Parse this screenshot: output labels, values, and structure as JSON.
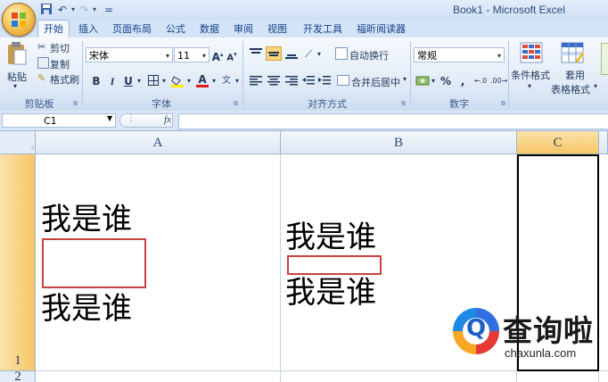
{
  "window": {
    "title": "Book1 - Microsoft Excel"
  },
  "quick_access": {
    "undo_icon": "undo-icon",
    "redo_icon": "redo-icon",
    "save_icon": "save-icon",
    "customize": "="
  },
  "tabs": [
    "开始",
    "插入",
    "页面布局",
    "公式",
    "数据",
    "审阅",
    "视图",
    "开发工具",
    "福昕阅读器"
  ],
  "active_tab": "开始",
  "ribbon": {
    "clipboard": {
      "paste": "粘贴",
      "cut": "剪切",
      "copy": "复制",
      "format_painter": "格式刷",
      "label": "剪贴板"
    },
    "font": {
      "family": "宋体",
      "size": "11",
      "grow": "A",
      "shrink": "A",
      "bold": "B",
      "italic": "I",
      "underline": "U",
      "label": "字体"
    },
    "alignment": {
      "wrap": "自动换行",
      "merge": "合并后居中",
      "label": "对齐方式"
    },
    "number": {
      "format": "常规",
      "currency": "%",
      "comma": ",",
      "label": "数字"
    },
    "styles": {
      "conditional": "条件格式",
      "table_line1": "套用",
      "table_line2": "表格格式"
    }
  },
  "formula_bar": {
    "name_box": "C1",
    "fx": "fx",
    "value": ""
  },
  "columns": [
    "A",
    "B",
    "C"
  ],
  "selected_column": "C",
  "rows": [
    "1",
    "2"
  ],
  "cells": {
    "A1": {
      "line1": "我是谁",
      "line2": "我是谁"
    },
    "B1": {
      "line1": "我是谁",
      "line2": "我是谁"
    }
  },
  "colors": {
    "selection": "#000000",
    "header_highlight": "#f7c667",
    "annotation_box": "#c9423f"
  },
  "watermark": {
    "title": "查询啦",
    "subtitle": "chaxunla.com"
  }
}
